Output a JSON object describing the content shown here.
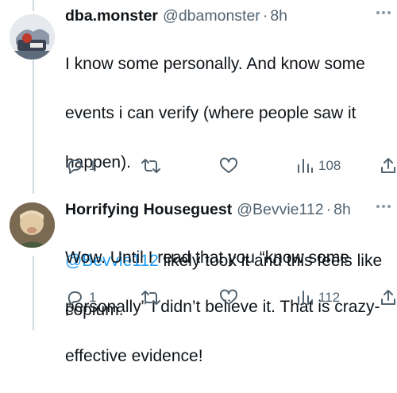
{
  "tweets": [
    {
      "name": "dba.monster",
      "handle": "@dbamonster",
      "separator": "·",
      "time": "8h",
      "text_line1": "I know some personally. And know some",
      "text_line2": "events i can verify (where people saw it",
      "text_line3": "happen).",
      "mention": "@Bevvie112",
      "text_after_mention": " likely took it and this feels like",
      "text_line5": "copium.",
      "replies": "1",
      "views": "108",
      "avatar_icon": "avatar-cartoon-icon"
    },
    {
      "name": "Horrifying Houseguest",
      "handle": "@Bevvie112",
      "separator": "·",
      "time": "8h",
      "text_line1": "Wow. Until I read that you “know some",
      "text_line2": "personally” I didn’t believe it. That is crazy-",
      "text_line3": "effective evidence!",
      "replies": "1",
      "views": "112",
      "avatar_icon": "avatar-photo-icon"
    }
  ],
  "icons": [
    "reply-icon",
    "retweet-icon",
    "like-icon",
    "views-icon",
    "share-icon",
    "more-icon"
  ],
  "colors": {
    "text": "#0f1419",
    "secondary": "#536471",
    "link": "#1d9bf0",
    "line": "#cfd9de"
  }
}
